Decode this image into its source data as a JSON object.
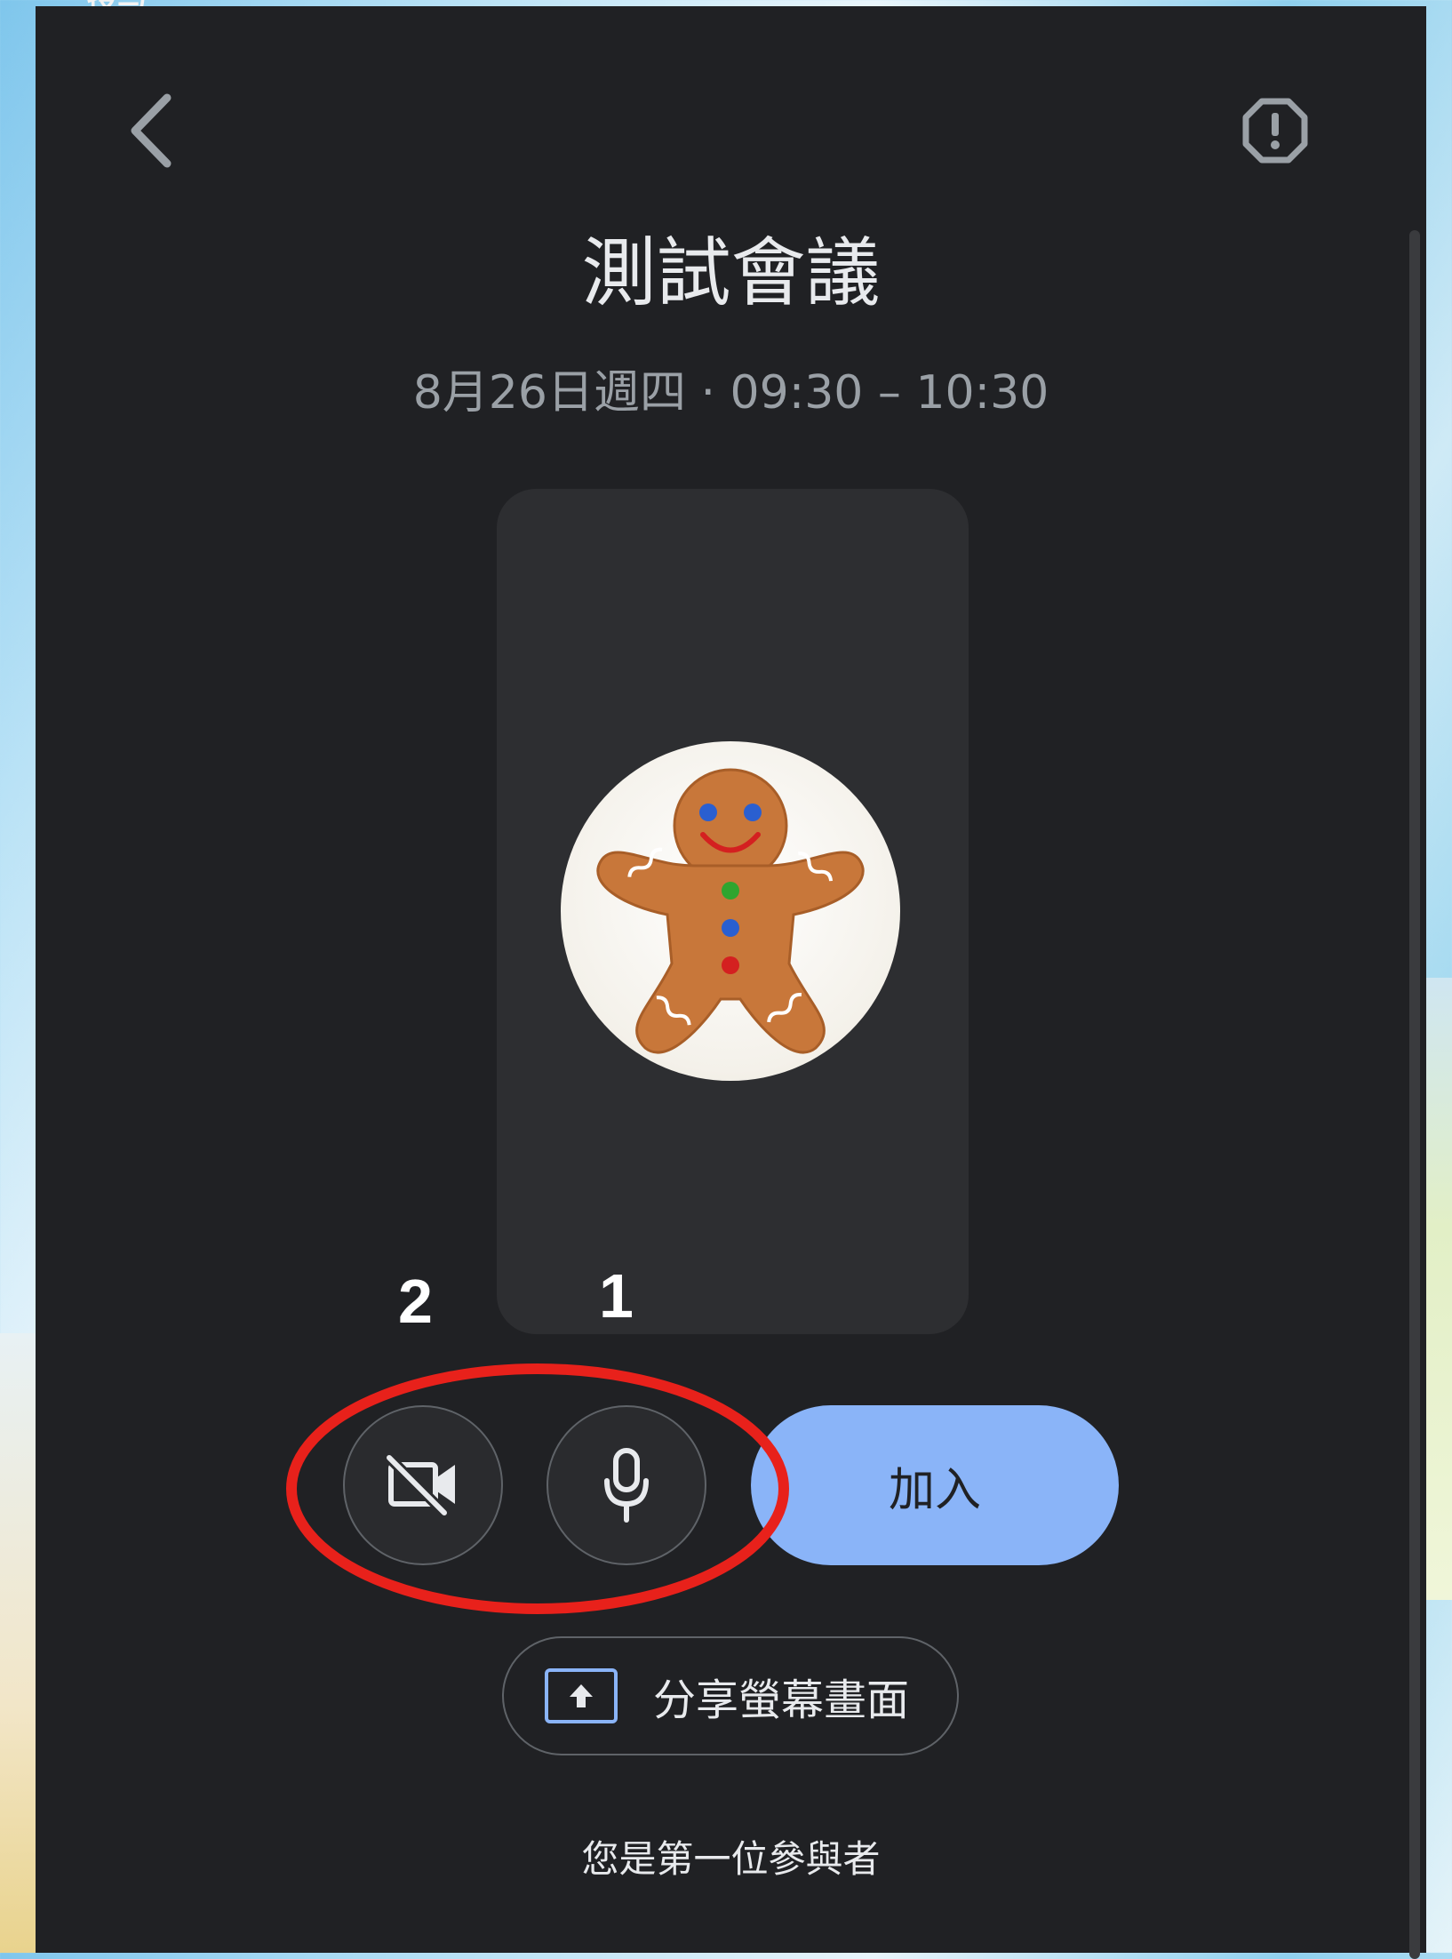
{
  "background": {
    "partial_text": "授与"
  },
  "header": {
    "back_icon": "chevron-left-icon",
    "report_icon": "report-icon"
  },
  "meeting": {
    "title": "測試會議",
    "datetime": "8月26日週四 · 09:30 – 10:30"
  },
  "preview": {
    "avatar": "gingerbread-man-avatar"
  },
  "annotations": {
    "label_1": "1",
    "label_2": "2",
    "highlight_color": "#e8211b"
  },
  "controls": {
    "camera_icon": "camera-off-icon",
    "mic_icon": "microphone-icon",
    "join_label": "加入",
    "share_label": "分享螢幕畫面",
    "share_icon": "present-screen-icon"
  },
  "footer": {
    "participant_text": "您是第一位參與者"
  },
  "colors": {
    "surface": "#202124",
    "accent": "#8ab4f8",
    "text": "#e8eaed",
    "secondary_text": "#9aa0a6"
  }
}
